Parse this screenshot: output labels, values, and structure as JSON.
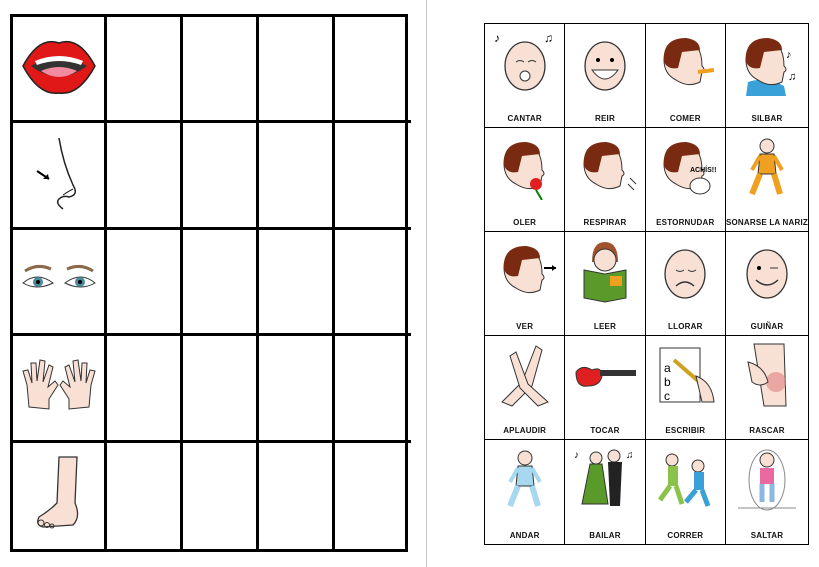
{
  "senses_table": {
    "rows": [
      {
        "icon": "mouth-icon"
      },
      {
        "icon": "nose-icon"
      },
      {
        "icon": "eyes-icon"
      },
      {
        "icon": "hands-icon"
      },
      {
        "icon": "foot-icon"
      }
    ],
    "empty_columns": 4
  },
  "action_cards": [
    {
      "label": "CANTAR",
      "icon": "singing-face-icon"
    },
    {
      "label": "REIR",
      "icon": "laughing-face-icon"
    },
    {
      "label": "COMER",
      "icon": "eating-icon"
    },
    {
      "label": "SILBAR",
      "icon": "whistling-icon"
    },
    {
      "label": "OLER",
      "icon": "smelling-flower-icon"
    },
    {
      "label": "RESPIRAR",
      "icon": "breathing-icon"
    },
    {
      "label": "ESTORNUDAR",
      "icon": "sneezing-icon",
      "caption": "ACHÍS!!"
    },
    {
      "label": "SONARSE LA NARIZ",
      "icon": "blowing-nose-icon"
    },
    {
      "label": "VER",
      "icon": "seeing-icon"
    },
    {
      "label": "LEER",
      "icon": "reading-icon"
    },
    {
      "label": "LLORAR",
      "icon": "crying-face-icon"
    },
    {
      "label": "GUIÑAR",
      "icon": "winking-face-icon"
    },
    {
      "label": "APLAUDIR",
      "icon": "clapping-icon"
    },
    {
      "label": "TOCAR",
      "icon": "guitar-icon"
    },
    {
      "label": "ESCRIBIR",
      "icon": "writing-icon"
    },
    {
      "label": "RASCAR",
      "icon": "scratching-icon"
    },
    {
      "label": "ANDAR",
      "icon": "walking-icon"
    },
    {
      "label": "BAILAR",
      "icon": "dancing-icon"
    },
    {
      "label": "CORRER",
      "icon": "running-icon"
    },
    {
      "label": "SALTAR",
      "icon": "jumping-rope-icon"
    }
  ],
  "colors": {
    "skin": "#f9e0d4",
    "hair": "#7a2a10",
    "border": "#000000"
  }
}
